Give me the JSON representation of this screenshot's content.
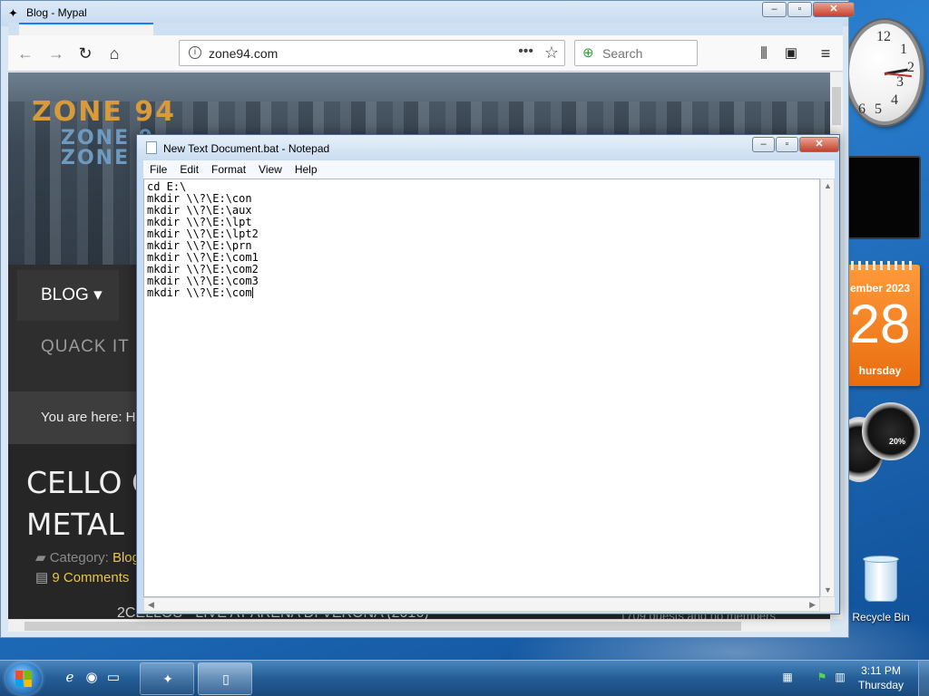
{
  "browser": {
    "title": "Blog - Mypal",
    "url": "zone94.com",
    "search_placeholder": "Search",
    "site": {
      "logo_main": "ZONE 94",
      "logo_shadow_1": "ZONE 9",
      "logo_shadow_2": "ZONE 9",
      "menu_blog": "BLOG",
      "menu_quack": "QUACK IT",
      "breadcrumb": "You are here:  H",
      "article_title_line1": "CELLO CR",
      "article_title_line2": "METAL",
      "category_label": "Category:",
      "category_value": "Blog",
      "comments": "9 Comments",
      "footer_left": "2CELLOS - LIVE AT ARENA DI VERONA (2016)",
      "footer_right": "1709 guests and no members"
    }
  },
  "notepad": {
    "title": "New Text Document.bat - Notepad",
    "menus": [
      "File",
      "Edit",
      "Format",
      "View",
      "Help"
    ],
    "lines": [
      "cd E:\\",
      "mkdir \\\\?\\E:\\con",
      "mkdir \\\\?\\E:\\aux",
      "mkdir \\\\?\\E:\\lpt",
      "mkdir \\\\?\\E:\\lpt2",
      "mkdir \\\\?\\E:\\prn",
      "mkdir \\\\?\\E:\\com1",
      "mkdir \\\\?\\E:\\com2",
      "mkdir \\\\?\\E:\\com3",
      "mkdir \\\\?\\E:\\com"
    ]
  },
  "desktop": {
    "clock_numbers": [
      "12",
      "1",
      "2",
      "3",
      "4",
      "5",
      "6"
    ],
    "calendar": {
      "month": "ember 2023",
      "day": "28",
      "weekday": "hursday"
    },
    "cpu_meter_percent": "20%",
    "recycle_bin_label": "Recycle Bin"
  },
  "taskbar": {
    "time": "3:11 PM",
    "day": "Thursday"
  },
  "colors": {
    "notepad_title_bg": "#c9dcf1",
    "calendar_orange": "#e86d0f",
    "site_accent": "#e8c548"
  }
}
